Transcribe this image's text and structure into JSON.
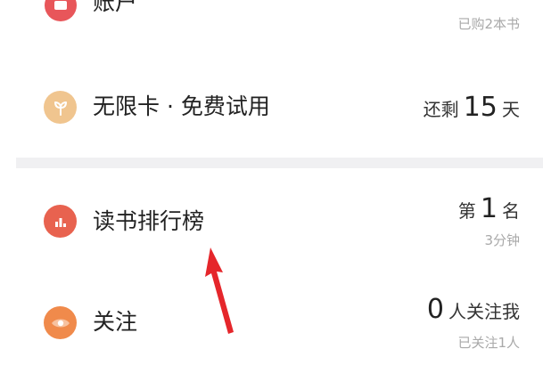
{
  "items": [
    {
      "label": "账户",
      "sub": "已购2本书",
      "icon": "account-icon",
      "icon_color": "#e8565a"
    },
    {
      "label": "无限卡 · 免费试用",
      "value_prefix": "还剩",
      "value": "15",
      "value_suffix": "天",
      "icon": "sprout-icon",
      "icon_color": "#f0c58f"
    },
    {
      "label": "读书排行榜",
      "value_prefix": "第",
      "value": "1",
      "value_suffix": "名",
      "sub": "3分钟",
      "icon": "bar-chart-icon",
      "icon_color": "#e8624f"
    },
    {
      "label": "关注",
      "value": "0",
      "value_suffix": "人关注我",
      "sub": "已关注1人",
      "icon": "eye-icon",
      "icon_color": "#f08a4b"
    }
  ],
  "annotation": {
    "arrow_color": "#e5262b"
  }
}
